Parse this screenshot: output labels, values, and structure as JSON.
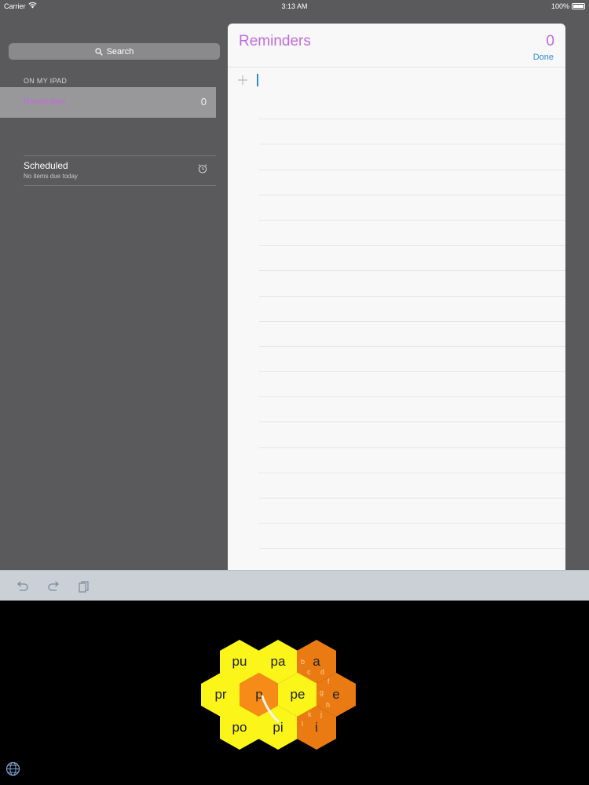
{
  "status_bar": {
    "carrier": "Carrier",
    "time": "3:13 AM",
    "battery": "100%"
  },
  "sidebar": {
    "search_label": "Search",
    "section_header": "ON MY IPAD",
    "selected_list": {
      "name": "Reminders",
      "count": "0"
    },
    "scheduled": {
      "title": "Scheduled",
      "subtitle": "No items due today"
    }
  },
  "reminders": {
    "title": "Reminders",
    "count": "0",
    "done_label": "Done"
  },
  "keyboard": {
    "keys": [
      {
        "label": "pu",
        "style": "yellow"
      },
      {
        "label": "pa",
        "style": "yellow"
      },
      {
        "label": "a",
        "style": "orange",
        "sub": [
          "b",
          "c",
          "d"
        ]
      },
      {
        "label": "pr",
        "style": "yellow"
      },
      {
        "label": "p",
        "style": "orange"
      },
      {
        "label": "pe",
        "style": "yellow"
      },
      {
        "label": "e",
        "style": "orange",
        "sub": [
          "f",
          "g",
          "h"
        ]
      },
      {
        "label": "po",
        "style": "yellow"
      },
      {
        "label": "pi",
        "style": "yellow"
      },
      {
        "label": "i",
        "style": "orange",
        "sub": [
          "k",
          "j",
          "l"
        ]
      }
    ]
  },
  "colors": {
    "accent_purple": "#c26adf",
    "link_blue": "#2a8bd9",
    "hex_yellow": "#fbf51a",
    "hex_orange": "#f68b18"
  },
  "icons": {
    "wifi": "wifi-icon",
    "search": "search-icon",
    "alarm": "alarm-clock-icon",
    "add": "plus-icon",
    "undo": "undo-icon",
    "redo": "redo-icon",
    "paste": "paste-icon",
    "globe": "globe-icon"
  }
}
